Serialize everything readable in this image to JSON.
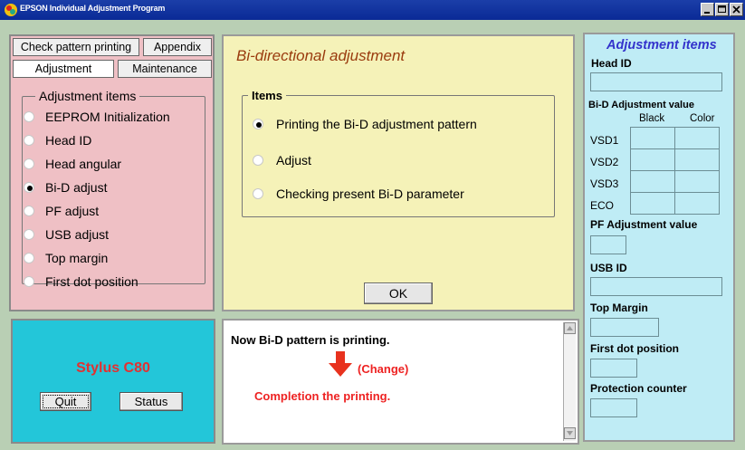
{
  "window": {
    "title": "EPSON Individual Adjustment Program",
    "icon": "epson-app-icon",
    "controls": [
      "minimize-icon",
      "maximize-icon",
      "close-icon"
    ]
  },
  "tabs": {
    "check_pattern": "Check pattern printing",
    "appendix": "Appendix",
    "adjustment": "Adjustment",
    "maintenance": "Maintenance",
    "active": "Adjustment"
  },
  "adjustment_items": {
    "legend": "Adjustment items",
    "options": [
      {
        "label": "EEPROM Initialization",
        "selected": false
      },
      {
        "label": "Head ID",
        "selected": false
      },
      {
        "label": "Head angular",
        "selected": false
      },
      {
        "label": "Bi-D adjust",
        "selected": true
      },
      {
        "label": "PF adjust",
        "selected": false
      },
      {
        "label": "USB adjust",
        "selected": false
      },
      {
        "label": "Top margin",
        "selected": false
      },
      {
        "label": "First dot position",
        "selected": false
      }
    ]
  },
  "center": {
    "title": "Bi-directional adjustment",
    "items_legend": "Items",
    "options": [
      {
        "label": "Printing the Bi-D adjustment pattern",
        "selected": true
      },
      {
        "label": "Adjust",
        "selected": false
      },
      {
        "label": "Checking present Bi-D parameter",
        "selected": false
      }
    ],
    "ok_label": "OK"
  },
  "right": {
    "title": "Adjustment items",
    "head_id_label": "Head ID",
    "bid_label": "Bi-D Adjustment value",
    "col_black": "Black",
    "col_color": "Color",
    "rows": [
      "VSD1",
      "VSD2",
      "VSD3",
      "ECO"
    ],
    "pf_label": "PF Adjustment value",
    "usb_label": "USB ID",
    "top_margin_label": "Top Margin",
    "first_dot_label": "First dot position",
    "protection_label": "Protection counter"
  },
  "model": {
    "name": "Stylus C80",
    "quit_label": "Quit",
    "status_label": "Status"
  },
  "message": {
    "line1": "Now Bi-D pattern is printing.",
    "change": "(Change)",
    "line3": "Completion the printing."
  },
  "colors": {
    "title_bar": "#0a2a96",
    "left_panel": "#efc0c5",
    "center_panel": "#f5f2b8",
    "right_panel": "#bfecf5",
    "model_panel": "#23c6d9",
    "accent_red": "#e22222"
  }
}
